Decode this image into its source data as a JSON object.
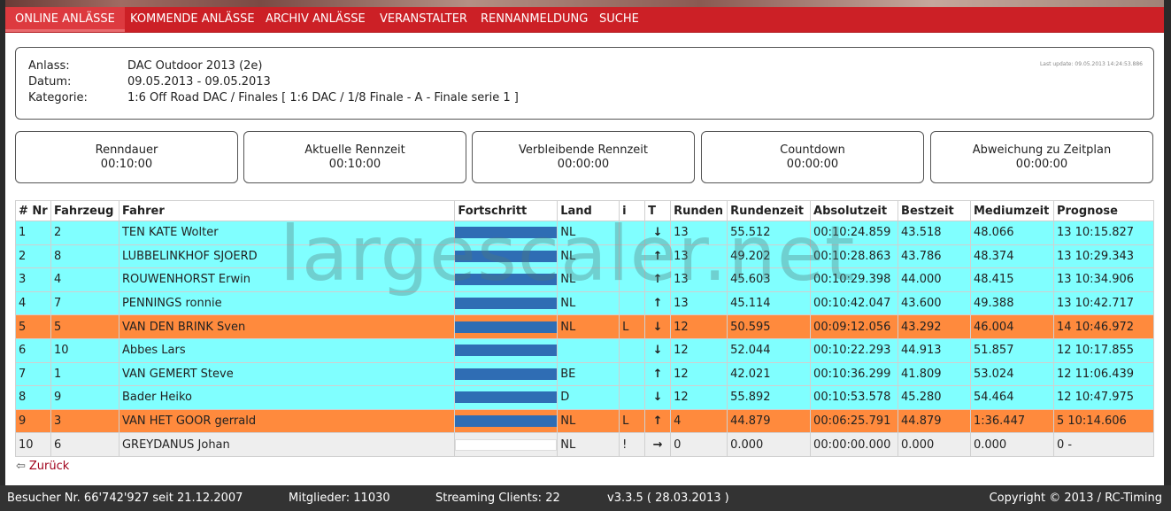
{
  "nav": {
    "items": [
      "ONLINE ANLÄSSE",
      "KOMMENDE ANLÄSSE",
      "ARCHIV ANLÄSSE",
      "VERANSTALTER",
      "RENNANMELDUNG",
      "SUCHE"
    ]
  },
  "event": {
    "anlass_label": "Anlass:",
    "anlass_value": "DAC Outdoor 2013 (2e)",
    "datum_label": "Datum:",
    "datum_value": "09.05.2013 - 09.05.2013",
    "kategorie_label": "Kategorie:",
    "kategorie_value": "1:6 Off Road DAC / Finales [ 1:6 DAC / 1/8 Finale - A - Finale serie 1 ]",
    "last_update": "Last update: 09.05.2013 14:24:53.886"
  },
  "timers": [
    {
      "label": "Renndauer",
      "value": "00:10:00"
    },
    {
      "label": "Aktuelle Rennzeit",
      "value": "00:10:00"
    },
    {
      "label": "Verbleibende Rennzeit",
      "value": "00:00:00"
    },
    {
      "label": "Countdown",
      "value": "00:00:00"
    },
    {
      "label": "Abweichung zu Zeitplan",
      "value": "00:00:00"
    }
  ],
  "table": {
    "headers": [
      "# Nr",
      "Fahrzeug",
      "Fahrer",
      "Fortschritt",
      "Land",
      "i",
      "T",
      "Runden",
      "Rundenzeit",
      "Absolutzeit",
      "Bestzeit",
      "Mediumzeit",
      "Prognose"
    ],
    "rows": [
      {
        "nr": "1",
        "fahrzeug": "2",
        "fahrer": "TEN KATE Wolter",
        "progress": 1.0,
        "land": "NL",
        "i": "",
        "t": "down",
        "runden": "13",
        "rundenzeit": "55.512",
        "absolutzeit": "00:10:24.859",
        "bestzeit": "43.518",
        "mediumzeit": "48.066",
        "prognose": "13 10:15.827",
        "status": "cyan"
      },
      {
        "nr": "2",
        "fahrzeug": "8",
        "fahrer": "LUBBELINKHOF SJOERD",
        "progress": 1.0,
        "land": "NL",
        "i": "",
        "t": "up",
        "runden": "13",
        "rundenzeit": "49.202",
        "absolutzeit": "00:10:28.863",
        "bestzeit": "43.786",
        "mediumzeit": "48.374",
        "prognose": "13 10:29.343",
        "status": "cyan"
      },
      {
        "nr": "3",
        "fahrzeug": "4",
        "fahrer": "ROUWENHORST Erwin",
        "progress": 1.0,
        "land": "NL",
        "i": "",
        "t": "up",
        "runden": "13",
        "rundenzeit": "45.603",
        "absolutzeit": "00:10:29.398",
        "bestzeit": "44.000",
        "mediumzeit": "48.415",
        "prognose": "13 10:34.906",
        "status": "cyan"
      },
      {
        "nr": "4",
        "fahrzeug": "7",
        "fahrer": "PENNINGS ronnie",
        "progress": 1.0,
        "land": "NL",
        "i": "",
        "t": "up",
        "runden": "13",
        "rundenzeit": "45.114",
        "absolutzeit": "00:10:42.047",
        "bestzeit": "43.600",
        "mediumzeit": "49.388",
        "prognose": "13 10:42.717",
        "status": "cyan"
      },
      {
        "nr": "5",
        "fahrzeug": "5",
        "fahrer": "VAN DEN BRINK Sven",
        "progress": 1.0,
        "land": "NL",
        "i": "L",
        "t": "down",
        "runden": "12",
        "rundenzeit": "50.595",
        "absolutzeit": "00:09:12.056",
        "bestzeit": "43.292",
        "mediumzeit": "46.004",
        "prognose": "14 10:46.972",
        "status": "orange"
      },
      {
        "nr": "6",
        "fahrzeug": "10",
        "fahrer": "Abbes Lars",
        "progress": 1.0,
        "land": "",
        "i": "",
        "t": "down",
        "runden": "12",
        "rundenzeit": "52.044",
        "absolutzeit": "00:10:22.293",
        "bestzeit": "44.913",
        "mediumzeit": "51.857",
        "prognose": "12 10:17.855",
        "status": "cyan"
      },
      {
        "nr": "7",
        "fahrzeug": "1",
        "fahrer": "VAN GEMERT Steve",
        "progress": 1.0,
        "land": "BE",
        "i": "",
        "t": "up",
        "runden": "12",
        "rundenzeit": "42.021",
        "absolutzeit": "00:10:36.299",
        "bestzeit": "41.809",
        "mediumzeit": "53.024",
        "prognose": "12 11:06.439",
        "status": "cyan"
      },
      {
        "nr": "8",
        "fahrzeug": "9",
        "fahrer": "Bader Heiko",
        "progress": 1.0,
        "land": "D",
        "i": "",
        "t": "down",
        "runden": "12",
        "rundenzeit": "55.892",
        "absolutzeit": "00:10:53.578",
        "bestzeit": "45.280",
        "mediumzeit": "54.464",
        "prognose": "12 10:47.975",
        "status": "cyan"
      },
      {
        "nr": "9",
        "fahrzeug": "3",
        "fahrer": "VAN HET GOOR gerrald",
        "progress": 1.0,
        "land": "NL",
        "i": "L",
        "t": "up",
        "runden": "4",
        "rundenzeit": "44.879",
        "absolutzeit": "00:06:25.791",
        "bestzeit": "44.879",
        "mediumzeit": "1:36.447",
        "prognose": "5 10:14.606",
        "status": "orange"
      },
      {
        "nr": "10",
        "fahrzeug": "6",
        "fahrer": "GREYDANUS Johan",
        "progress": 0.0,
        "land": "NL",
        "i": "!",
        "t": "right",
        "runden": "0",
        "rundenzeit": "0.000",
        "absolutzeit": "00:00:00.000",
        "bestzeit": "0.000",
        "mediumzeit": "0.000",
        "prognose": "0 -",
        "status": "gray"
      }
    ]
  },
  "back_label": "Zurück",
  "watermark": "largescaler.net",
  "footer": {
    "besucher": "Besucher Nr. 66'742'927 seit 21.12.2007",
    "mitglieder": "Mitglieder: 11030",
    "streaming": "Streaming Clients: 22",
    "version": "v3.3.5 ( 28.03.2013 )",
    "copyright": "Copyright © 2013 / RC-Timing"
  },
  "colors": {
    "nav_red": "#cc2026",
    "row_cyan": "#80ffff",
    "row_orange": "#ff8a3d",
    "progress_blue": "#2f6db4"
  }
}
